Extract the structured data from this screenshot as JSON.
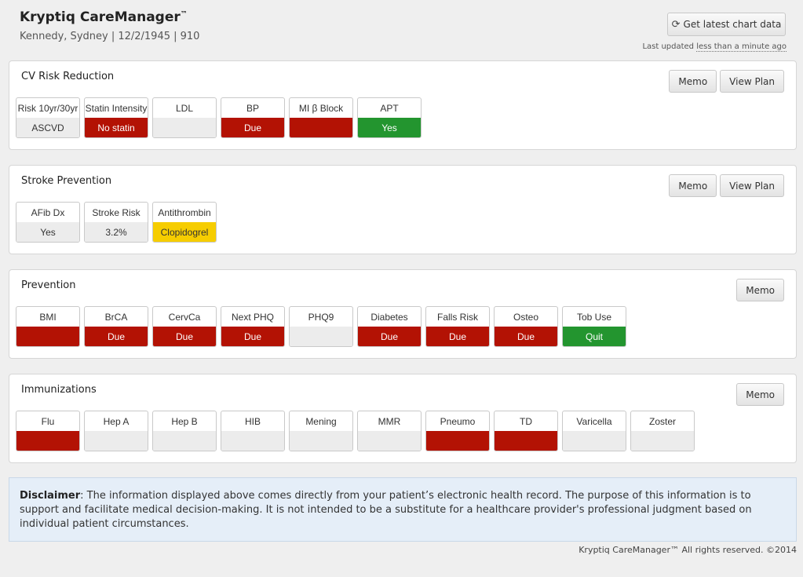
{
  "header": {
    "app_name": "Kryptiq CareManager",
    "trademark": "™",
    "patient_line": "Kennedy, Sydney | 12/2/1945 | 910",
    "refresh_label": "Get latest chart data",
    "refresh_icon": "refresh-icon",
    "last_updated_prefix": "Last updated ",
    "last_updated_relative": "less than a minute ago"
  },
  "colors": {
    "due_red": "#b31204",
    "ok_green": "#23952f",
    "warn_yellow": "#f6cd00",
    "neutral_gray": "#ececec"
  },
  "panels": [
    {
      "title": "CV Risk Reduction",
      "buttons": [
        "Memo",
        "View Plan"
      ],
      "tiles": [
        {
          "label": "Risk 10yr/30yr",
          "value": "ASCVD",
          "status": "gray"
        },
        {
          "label": "Statin Intensity",
          "value": "No statin",
          "status": "red"
        },
        {
          "label": "LDL",
          "value": "",
          "status": "gray"
        },
        {
          "label": "BP",
          "value": "Due",
          "status": "red"
        },
        {
          "label": "MI β Block",
          "value": "",
          "status": "red"
        },
        {
          "label": "APT",
          "value": "Yes",
          "status": "green"
        }
      ]
    },
    {
      "title": "Stroke Prevention",
      "buttons": [
        "Memo",
        "View Plan"
      ],
      "tiles": [
        {
          "label": "AFib Dx",
          "value": "Yes",
          "status": "gray"
        },
        {
          "label": "Stroke Risk",
          "value": "3.2%",
          "status": "gray"
        },
        {
          "label": "Antithrombin",
          "value": "Clopidogrel",
          "status": "yellow"
        }
      ]
    },
    {
      "title": "Prevention",
      "buttons": [
        "Memo"
      ],
      "tiles": [
        {
          "label": "BMI",
          "value": "",
          "status": "red"
        },
        {
          "label": "BrCA",
          "value": "Due",
          "status": "red"
        },
        {
          "label": "CervCa",
          "value": "Due",
          "status": "red"
        },
        {
          "label": "Next PHQ",
          "value": "Due",
          "status": "red"
        },
        {
          "label": "PHQ9",
          "value": "",
          "status": "gray"
        },
        {
          "label": "Diabetes",
          "value": "Due",
          "status": "red"
        },
        {
          "label": "Falls Risk",
          "value": "Due",
          "status": "red"
        },
        {
          "label": "Osteo",
          "value": "Due",
          "status": "red"
        },
        {
          "label": "Tob Use",
          "value": "Quit",
          "status": "green"
        }
      ]
    },
    {
      "title": "Immunizations",
      "buttons": [
        "Memo"
      ],
      "tiles": [
        {
          "label": "Flu",
          "value": "",
          "status": "red"
        },
        {
          "label": "Hep A",
          "value": "",
          "status": "gray"
        },
        {
          "label": "Hep B",
          "value": "",
          "status": "gray"
        },
        {
          "label": "HIB",
          "value": "",
          "status": "gray"
        },
        {
          "label": "Mening",
          "value": "",
          "status": "gray"
        },
        {
          "label": "MMR",
          "value": "",
          "status": "gray"
        },
        {
          "label": "Pneumo",
          "value": "",
          "status": "red"
        },
        {
          "label": "TD",
          "value": "",
          "status": "red"
        },
        {
          "label": "Varicella",
          "value": "",
          "status": "gray"
        },
        {
          "label": "Zoster",
          "value": "",
          "status": "gray"
        }
      ]
    }
  ],
  "disclaimer": {
    "heading": "Disclaimer",
    "text": ": The information displayed above comes directly from your patient’s electronic health record. The purpose of this information is to support and facilitate medical decision-making. It is not intended to be a substitute for a healthcare provider's professional judgment based on individual patient circumstances."
  },
  "footer": {
    "text": "Kryptiq CareManager™ All rights reserved. ©2014"
  }
}
